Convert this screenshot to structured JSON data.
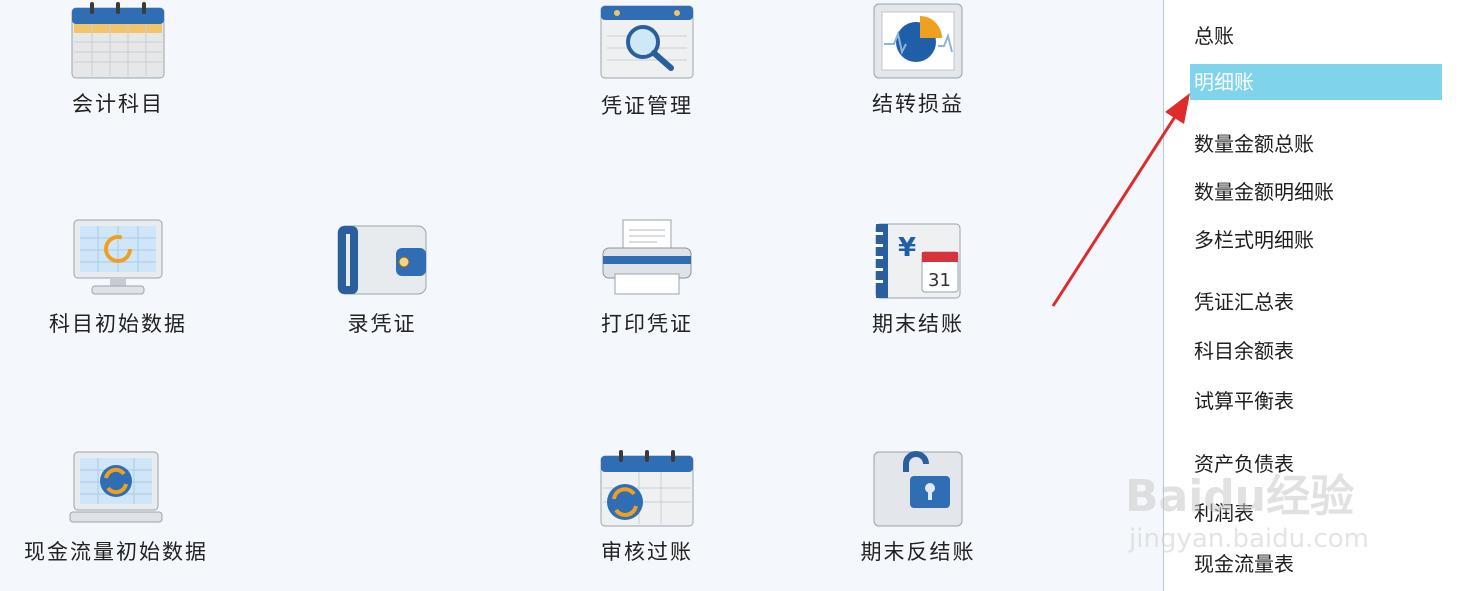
{
  "tiles": {
    "accounts": "会计科目",
    "voucher_manage": "凭证管理",
    "carry_forward": "结转损益",
    "opening_balance": "科目初始数据",
    "enter_voucher": "录凭证",
    "print_voucher": "打印凭证",
    "period_close": "期末结账",
    "cashflow_opening": "现金流量初始数据",
    "review_post": "审核过账",
    "reverse_close": "期末反结账"
  },
  "sidebar": {
    "items": [
      {
        "label": "总账",
        "selected": false
      },
      {
        "label": "明细账",
        "selected": true
      },
      {
        "label": "数量金额总账",
        "selected": false
      },
      {
        "label": "数量金额明细账",
        "selected": false
      },
      {
        "label": "多栏式明细账",
        "selected": false
      },
      {
        "label": "凭证汇总表",
        "selected": false
      },
      {
        "label": "科目余额表",
        "selected": false
      },
      {
        "label": "试算平衡表",
        "selected": false
      },
      {
        "label": "资产负债表",
        "selected": false
      },
      {
        "label": "利润表",
        "selected": false
      },
      {
        "label": "现金流量表",
        "selected": false
      }
    ]
  },
  "watermark": {
    "brand": "Baidu经验",
    "url": "jingyan.baidu.com"
  },
  "colors": {
    "selected_bg": "#7fd4ec",
    "arrow": "#e02b2b"
  }
}
